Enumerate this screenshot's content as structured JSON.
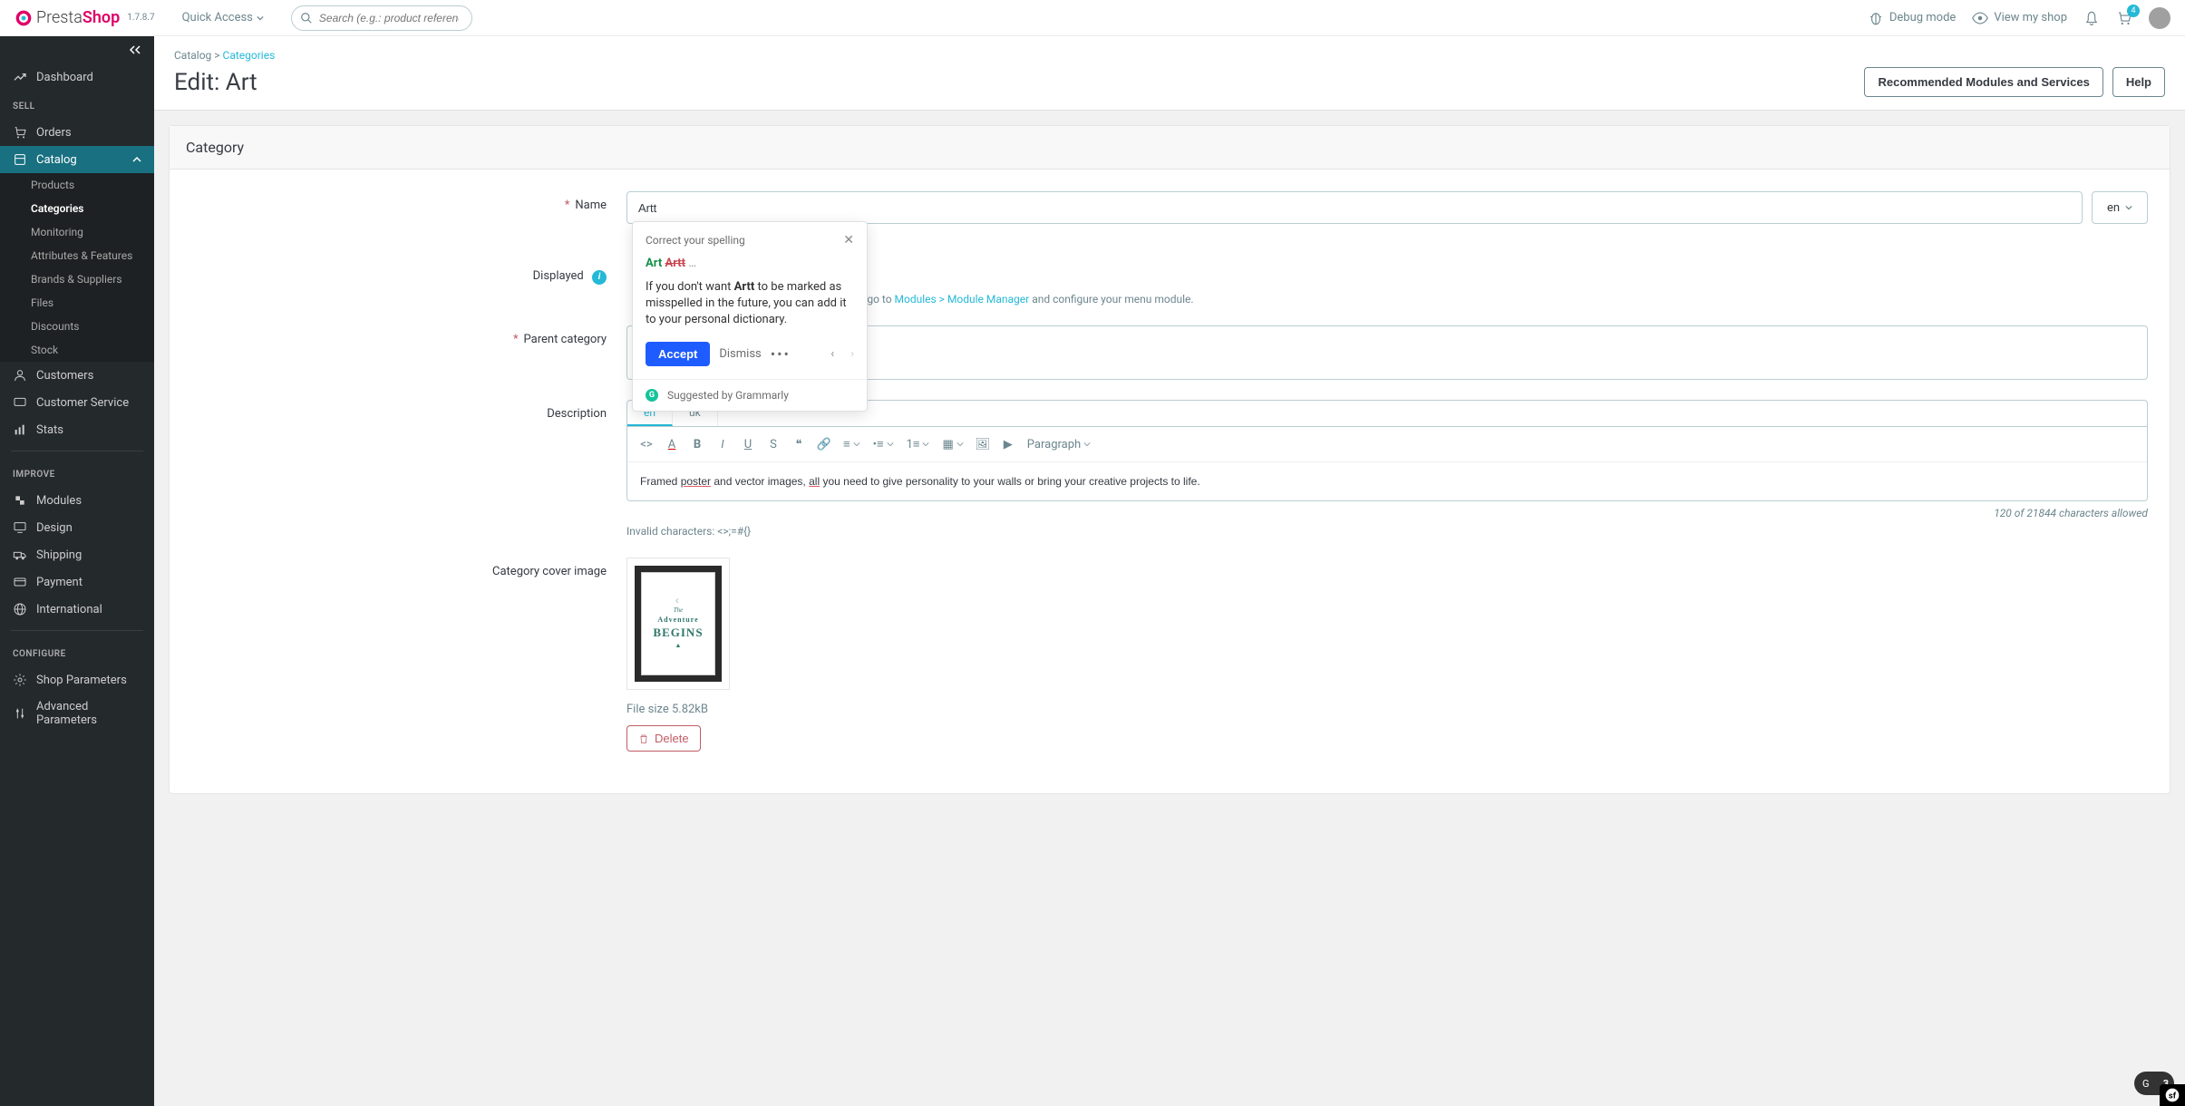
{
  "header": {
    "logo_presta": "Presta",
    "logo_shop": "Shop",
    "version": "1.7.8.7",
    "quick_access": "Quick Access",
    "search_placeholder": "Search (e.g.: product reference, custon",
    "debug_mode": "Debug mode",
    "view_shop": "View my shop",
    "cart_count": "4"
  },
  "sidebar": {
    "dashboard": "Dashboard",
    "sell_title": "SELL",
    "orders": "Orders",
    "catalog": "Catalog",
    "catalog_sub": {
      "products": "Products",
      "categories": "Categories",
      "monitoring": "Monitoring",
      "attributes": "Attributes & Features",
      "brands": "Brands & Suppliers",
      "files": "Files",
      "discounts": "Discounts",
      "stock": "Stock"
    },
    "customers": "Customers",
    "customer_service": "Customer Service",
    "stats": "Stats",
    "improve_title": "IMPROVE",
    "modules": "Modules",
    "design": "Design",
    "shipping": "Shipping",
    "payment": "Payment",
    "international": "International",
    "configure_title": "CONFIGURE",
    "shop_params": "Shop Parameters",
    "adv_params": "Advanced Parameters"
  },
  "page": {
    "breadcrumb_1": "Catalog",
    "breadcrumb_sep": " > ",
    "breadcrumb_2": "Categories",
    "title": "Edit: Art",
    "btn_modules": "Recommended Modules and Services",
    "btn_help": "Help"
  },
  "panel": {
    "title": "Category",
    "name_label": "Name",
    "name_value": "Artt",
    "lang": "en",
    "invalid_chars": "Invalid characters: <>;=#{}",
    "displayed_label": "Displayed",
    "displayed_note_before": ", go to ",
    "displayed_link": "Modules > Module Manager",
    "displayed_note_after": " and configure your menu module.",
    "parent_label": "Parent category",
    "description_label": "Description",
    "tab_en": "en",
    "tab_uk": "uk",
    "paragraph_btn": "Paragraph",
    "desc_text_1": "Framed ",
    "desc_text_poster": "poster",
    "desc_text_2": " and vector images, ",
    "desc_text_all": "all",
    "desc_text_3": " you need to give personality to your walls or bring your creative projects to life.",
    "char_count": "120 of 21844 characters allowed",
    "cover_label": "Category cover image",
    "poster_top": "The",
    "poster_mid1": "Adventure",
    "poster_mid2": "BEGINS",
    "file_size": "File size 5.82kB",
    "btn_delete": "Delete"
  },
  "grammarly": {
    "title": "Correct your spelling",
    "keep": "Art",
    "strike": "Artt",
    "explain_1": "If you don't want ",
    "explain_bold": "Artt",
    "explain_2": " to be marked as misspelled in the future, you can add it to your personal dictionary.",
    "accept": "Accept",
    "dismiss": "Dismiss",
    "suggested_by": "Suggested by Grammarly",
    "float_count": "3"
  }
}
